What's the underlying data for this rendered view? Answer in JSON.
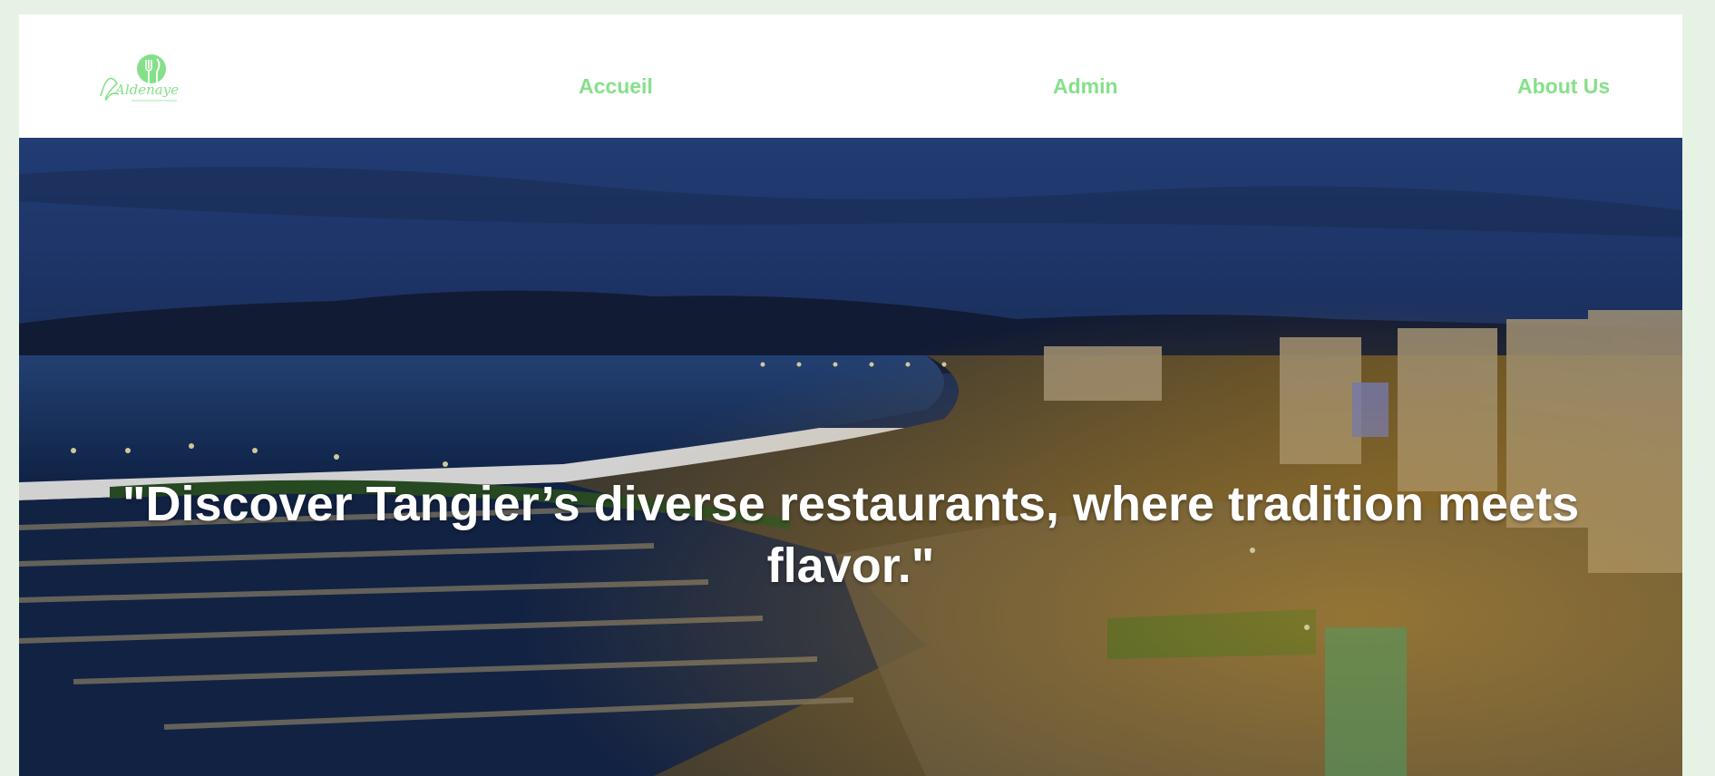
{
  "brand": {
    "logo_icon": "fork-knife-leaf-logo",
    "logo_text": "Aldenaye",
    "accent_color": "#86e08a"
  },
  "nav": {
    "items": [
      {
        "label": "Accueil"
      },
      {
        "label": "Admin"
      },
      {
        "label": "About Us"
      }
    ]
  },
  "hero": {
    "image": "night-aerial-view-of-tangier-bay-marina-and-corniche",
    "quote": "\"Discover Tangier’s diverse restaurants, where tradition meets flavor.\""
  }
}
